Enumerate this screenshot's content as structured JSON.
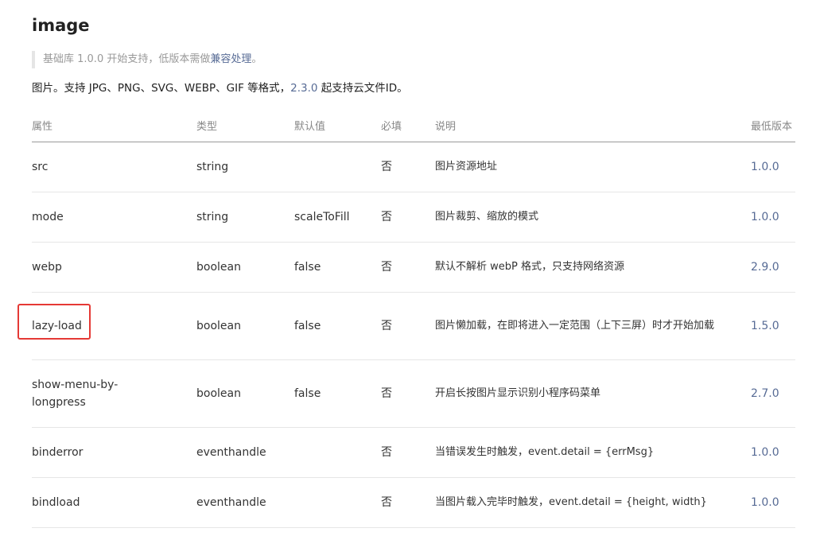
{
  "page": {
    "title": "image",
    "note_prefix": "基础库 1.0.0 开始支持，低版本需做",
    "note_link": "兼容处理",
    "note_suffix": "。",
    "desc_prefix": "图片。支持 JPG、PNG、SVG、WEBP、GIF 等格式，",
    "desc_version": "2.3.0",
    "desc_suffix": " 起支持云文件ID。"
  },
  "table": {
    "headers": [
      "属性",
      "类型",
      "默认值",
      "必填",
      "说明",
      "最低版本"
    ],
    "rows": [
      {
        "name": "src",
        "type": "string",
        "default": "",
        "required": "否",
        "desc": "图片资源地址",
        "version": "1.0.0"
      },
      {
        "name": "mode",
        "type": "string",
        "default": "scaleToFill",
        "required": "否",
        "desc": "图片裁剪、缩放的模式",
        "version": "1.0.0"
      },
      {
        "name": "webp",
        "type": "boolean",
        "default": "false",
        "required": "否",
        "desc": "默认不解析 webP 格式，只支持网络资源",
        "version": "2.9.0"
      },
      {
        "name": "lazy-load",
        "type": "boolean",
        "default": "false",
        "required": "否",
        "desc": "图片懒加载，在即将进入一定范围（上下三屏）时才开始加载",
        "version": "1.5.0"
      },
      {
        "name": "show-menu-by-longpress",
        "type": "boolean",
        "default": "false",
        "required": "否",
        "desc": "开启长按图片显示识别小程序码菜单",
        "version": "2.7.0"
      },
      {
        "name": "binderror",
        "type": "eventhandle",
        "default": "",
        "required": "否",
        "desc": "当错误发生时触发，event.detail = {errMsg}",
        "version": "1.0.0"
      },
      {
        "name": "bindload",
        "type": "eventhandle",
        "default": "",
        "required": "否",
        "desc": "当图片载入完毕时触发，event.detail = {height, width}",
        "version": "1.0.0"
      }
    ]
  },
  "highlight": {
    "color": "#e53935",
    "target": "lazy-load"
  },
  "colors": {
    "link": "#576b95",
    "muted": "#999999"
  }
}
